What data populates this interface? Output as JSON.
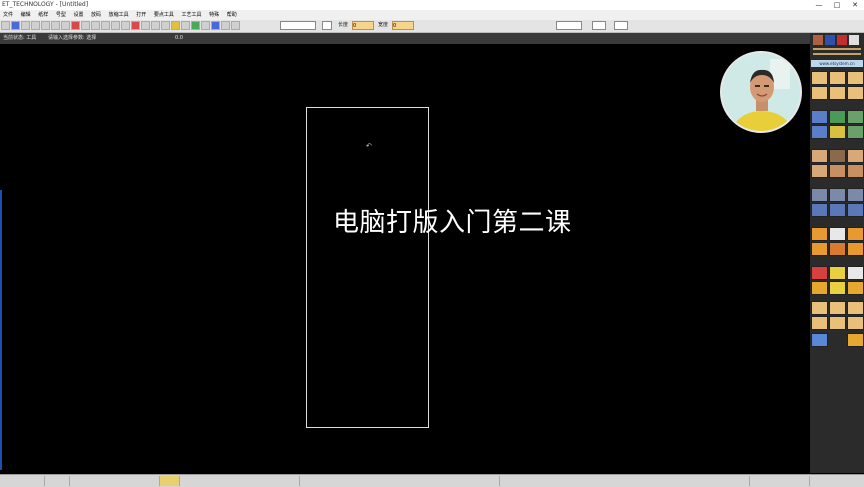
{
  "window": {
    "title": "ET_TECHNOLOGY - [Untitled]",
    "controls": [
      "—",
      "□",
      "✕"
    ]
  },
  "menu": [
    "文件",
    "编辑",
    "纸样",
    "号型",
    "设置",
    "放码",
    "放缩工具",
    "打开",
    "要点工具",
    "工艺工具",
    "特殊",
    "帮助"
  ],
  "toolbar": {
    "field_label_1": "长度",
    "field_label_2": "宽度",
    "field_value_1": "0",
    "field_value_2": "0"
  },
  "status": {
    "mode": "当前状态: 工具",
    "hint": "请输入选择参数: 选择",
    "value": "0.0"
  },
  "canvas": {
    "overlay_title": "电脑打版入门第二课",
    "cursor_glyph": "↶"
  },
  "right_panel": {
    "banner": "www.etsystem.cn"
  },
  "colors": {
    "canvas_bg": "#000000",
    "piece_outline": "#dcdcdc",
    "accent_blue": "#1b4fb0"
  }
}
